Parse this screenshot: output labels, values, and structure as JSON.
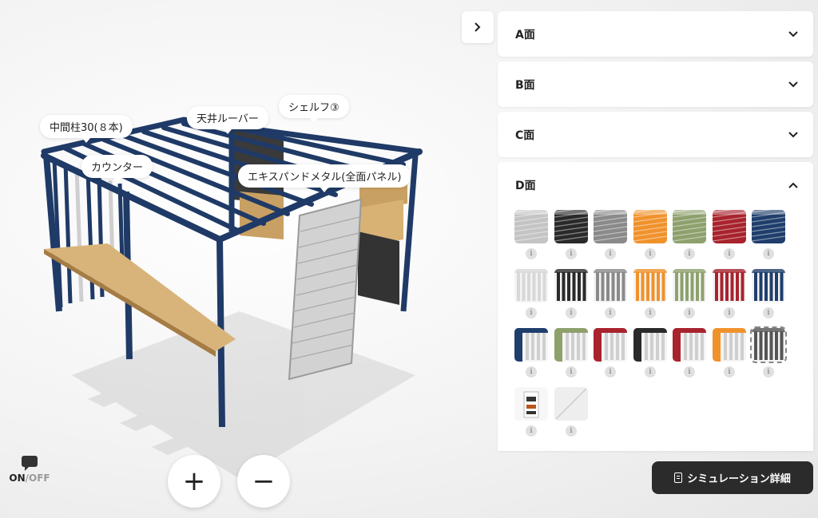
{
  "viewport": {
    "labels": {
      "middle_pillar": "中間柱30(８本)",
      "roof_louver": "天井ルーバー",
      "shelf": "シェルフ③",
      "counter": "カウンター",
      "expanded_metal": "エキスパンドメタル(全面パネル)"
    },
    "toggle": {
      "on": "ON",
      "slash": "/",
      "off": "OFF"
    },
    "zoom_in_label": "+",
    "zoom_out_label": "−"
  },
  "panel": {
    "collapse_icon": "chevron-right-icon",
    "sections": [
      {
        "title": "A面",
        "state": "collapsed"
      },
      {
        "title": "B面",
        "state": "collapsed"
      },
      {
        "title": "C面",
        "state": "collapsed"
      },
      {
        "title": "D面",
        "state": "expanded"
      }
    ],
    "info_label": "i",
    "swatches": [
      {
        "kind": "mesh",
        "color": "#c4c4c4"
      },
      {
        "kind": "mesh",
        "color": "#2a2a2a"
      },
      {
        "kind": "mesh",
        "color": "#8a8a8a"
      },
      {
        "kind": "mesh",
        "color": "#f0922c"
      },
      {
        "kind": "mesh",
        "color": "#8ea16d"
      },
      {
        "kind": "mesh",
        "color": "#a8232d"
      },
      {
        "kind": "mesh",
        "color": "#1f3e6c"
      },
      {
        "kind": "louver",
        "color": "#d8d8d8"
      },
      {
        "kind": "louver",
        "color": "#2a2a2a"
      },
      {
        "kind": "louver",
        "color": "#8a8a8a"
      },
      {
        "kind": "louver",
        "color": "#f0922c"
      },
      {
        "kind": "louver",
        "color": "#8ea16d"
      },
      {
        "kind": "louver",
        "color": "#a8232d"
      },
      {
        "kind": "louver",
        "color": "#1f3e6c"
      },
      {
        "kind": "louver-mix",
        "color": "#1f3e6c"
      },
      {
        "kind": "louver-mix",
        "color": "#8ea16d"
      },
      {
        "kind": "louver-mix",
        "color": "#a8232d"
      },
      {
        "kind": "louver-mix",
        "color": "#2a2a2a"
      },
      {
        "kind": "louver-mix",
        "color": "#a8232d"
      },
      {
        "kind": "louver-mix",
        "color": "#f0922c"
      },
      {
        "kind": "louver-selected",
        "color": "#555555"
      },
      {
        "kind": "shelf-unit",
        "color": "#b8541e"
      },
      {
        "kind": "none",
        "color": "#eeeeee"
      }
    ]
  },
  "detail_button_label": "シミュレーション詳細"
}
